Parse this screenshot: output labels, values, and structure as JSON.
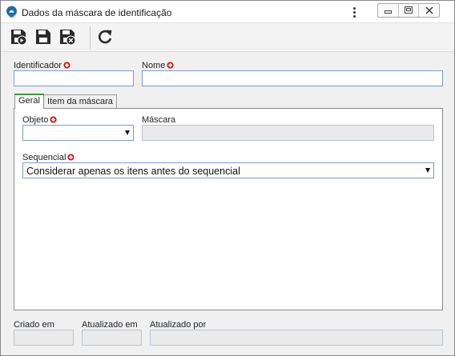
{
  "window": {
    "title": "Dados da máscara de identificação",
    "controls": [
      "minimize-icon",
      "restore-icon",
      "close-icon"
    ]
  },
  "toolbar": {
    "buttons": [
      "save-new-icon",
      "save-icon",
      "save-close-icon",
      "refresh-icon"
    ]
  },
  "form": {
    "identificador_label": "Identificador",
    "identificador_value": "",
    "nome_label": "Nome",
    "nome_value": ""
  },
  "tabs": [
    {
      "label": "Geral",
      "active": true
    },
    {
      "label": "Item da máscara",
      "active": false
    }
  ],
  "geral": {
    "objeto_label": "Objeto",
    "objeto_value": "",
    "mascara_label": "Máscara",
    "mascara_value": "",
    "sequencial_label": "Sequencial",
    "sequencial_value": "Considerar apenas os itens antes do sequencial"
  },
  "footer": {
    "criado_em_label": "Criado em",
    "criado_em_value": "",
    "atualizado_em_label": "Atualizado em",
    "atualizado_em_value": "",
    "atualizado_por_label": "Atualizado por",
    "atualizado_por_value": ""
  },
  "colors": {
    "required_marker": "#d40000",
    "active_tab_accent": "#3a9a3a",
    "input_border": "#7a9cc6",
    "app_icon": "#1f6fa8"
  }
}
